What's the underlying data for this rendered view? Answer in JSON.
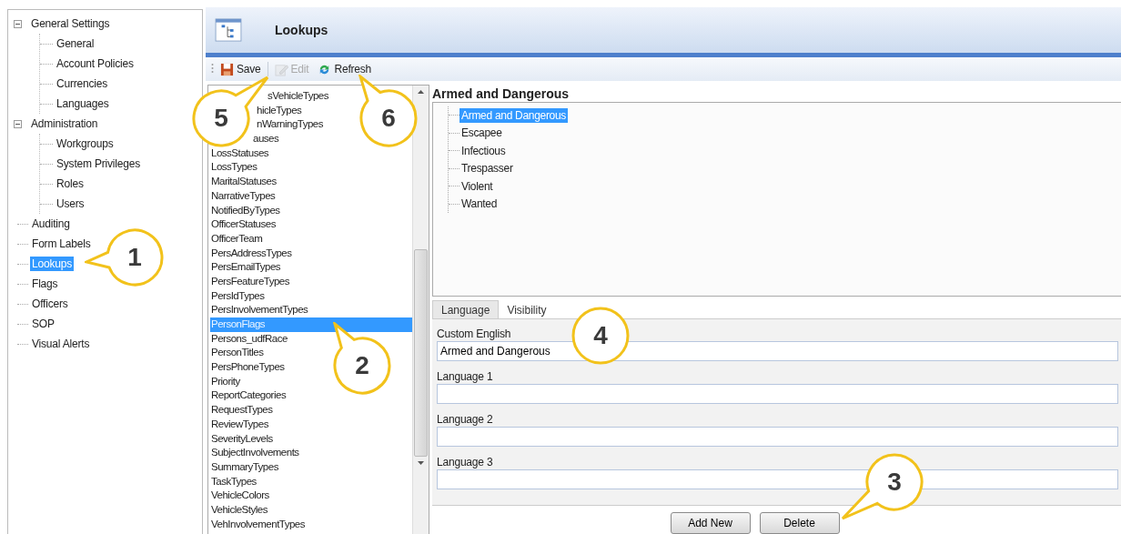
{
  "sidebar": {
    "tree": [
      {
        "label": "General Settings",
        "expanded": true,
        "selected": false,
        "children": [
          {
            "label": "General",
            "selected": false
          },
          {
            "label": "Account Policies",
            "selected": false
          },
          {
            "label": "Currencies",
            "selected": false
          },
          {
            "label": "Languages",
            "selected": false
          }
        ]
      },
      {
        "label": "Administration",
        "expanded": true,
        "selected": false,
        "children": [
          {
            "label": "Workgroups",
            "selected": false
          },
          {
            "label": "System Privileges",
            "selected": false
          },
          {
            "label": "Roles",
            "selected": false
          },
          {
            "label": "Users",
            "selected": false
          }
        ]
      },
      {
        "label": "Auditing",
        "selected": false
      },
      {
        "label": "Form Labels",
        "selected": false
      },
      {
        "label": "Lookups",
        "selected": true
      },
      {
        "label": "Flags",
        "selected": false
      },
      {
        "label": "Officers",
        "selected": false
      },
      {
        "label": "SOP",
        "selected": false
      },
      {
        "label": "Visual Alerts",
        "selected": false
      }
    ]
  },
  "header": {
    "title": "Lookups"
  },
  "toolbar": [
    {
      "label": "Save",
      "kind": "save",
      "disabled": false
    },
    {
      "label": "Edit",
      "kind": "edit",
      "disabled": true
    },
    {
      "label": "Refresh",
      "kind": "refresh",
      "disabled": false
    }
  ],
  "lookup_list": [
    {
      "label": "sVehicleTypes",
      "selected": false
    },
    {
      "label": "hicleTypes",
      "selected": false
    },
    {
      "label": "nWarningTypes",
      "selected": false
    },
    {
      "label": "auses",
      "selected": false
    },
    {
      "label": "LossStatuses",
      "selected": false
    },
    {
      "label": "LossTypes",
      "selected": false
    },
    {
      "label": "MaritalStatuses",
      "selected": false
    },
    {
      "label": "NarrativeTypes",
      "selected": false
    },
    {
      "label": "NotifiedByTypes",
      "selected": false
    },
    {
      "label": "OfficerStatuses",
      "selected": false
    },
    {
      "label": "OfficerTeam",
      "selected": false
    },
    {
      "label": "PersAddressTypes",
      "selected": false
    },
    {
      "label": "PersEmailTypes",
      "selected": false
    },
    {
      "label": "PersFeatureTypes",
      "selected": false
    },
    {
      "label": "PersIdTypes",
      "selected": false
    },
    {
      "label": "PersInvolvementTypes",
      "selected": false
    },
    {
      "label": "PersonFlags",
      "selected": true
    },
    {
      "label": "Persons_udfRace",
      "selected": false
    },
    {
      "label": "PersonTitles",
      "selected": false
    },
    {
      "label": "PersPhoneTypes",
      "selected": false
    },
    {
      "label": "Priority",
      "selected": false
    },
    {
      "label": "ReportCategories",
      "selected": false
    },
    {
      "label": "RequestTypes",
      "selected": false
    },
    {
      "label": "ReviewTypes",
      "selected": false
    },
    {
      "label": "SeverityLevels",
      "selected": false
    },
    {
      "label": "SubjectInvolvements",
      "selected": false
    },
    {
      "label": "SummaryTypes",
      "selected": false
    },
    {
      "label": "TaskTypes",
      "selected": false
    },
    {
      "label": "VehicleColors",
      "selected": false
    },
    {
      "label": "VehicleStyles",
      "selected": false
    },
    {
      "label": "VehInvolvementTypes",
      "selected": false
    }
  ],
  "detail": {
    "title": "Armed and Dangerous",
    "values": [
      {
        "label": "Armed and Dangerous",
        "selected": true
      },
      {
        "label": "Escapee",
        "selected": false
      },
      {
        "label": "Infectious",
        "selected": false
      },
      {
        "label": "Trespasser",
        "selected": false
      },
      {
        "label": "Violent",
        "selected": false
      },
      {
        "label": "Wanted",
        "selected": false
      }
    ],
    "tabs": [
      {
        "label": "Language",
        "selected": true
      },
      {
        "label": "Visibility",
        "selected": false
      }
    ],
    "fields": [
      {
        "label": "Custom English",
        "value": "Armed and Dangerous"
      },
      {
        "label": "Language 1"
      },
      {
        "label": "Language 2"
      },
      {
        "label": "Language 3"
      }
    ],
    "buttons": [
      "Add New",
      "Delete"
    ]
  },
  "callouts": [
    {
      "number": "1"
    },
    {
      "number": "2"
    },
    {
      "number": "3"
    },
    {
      "number": "4"
    },
    {
      "number": "5"
    },
    {
      "number": "6"
    }
  ]
}
